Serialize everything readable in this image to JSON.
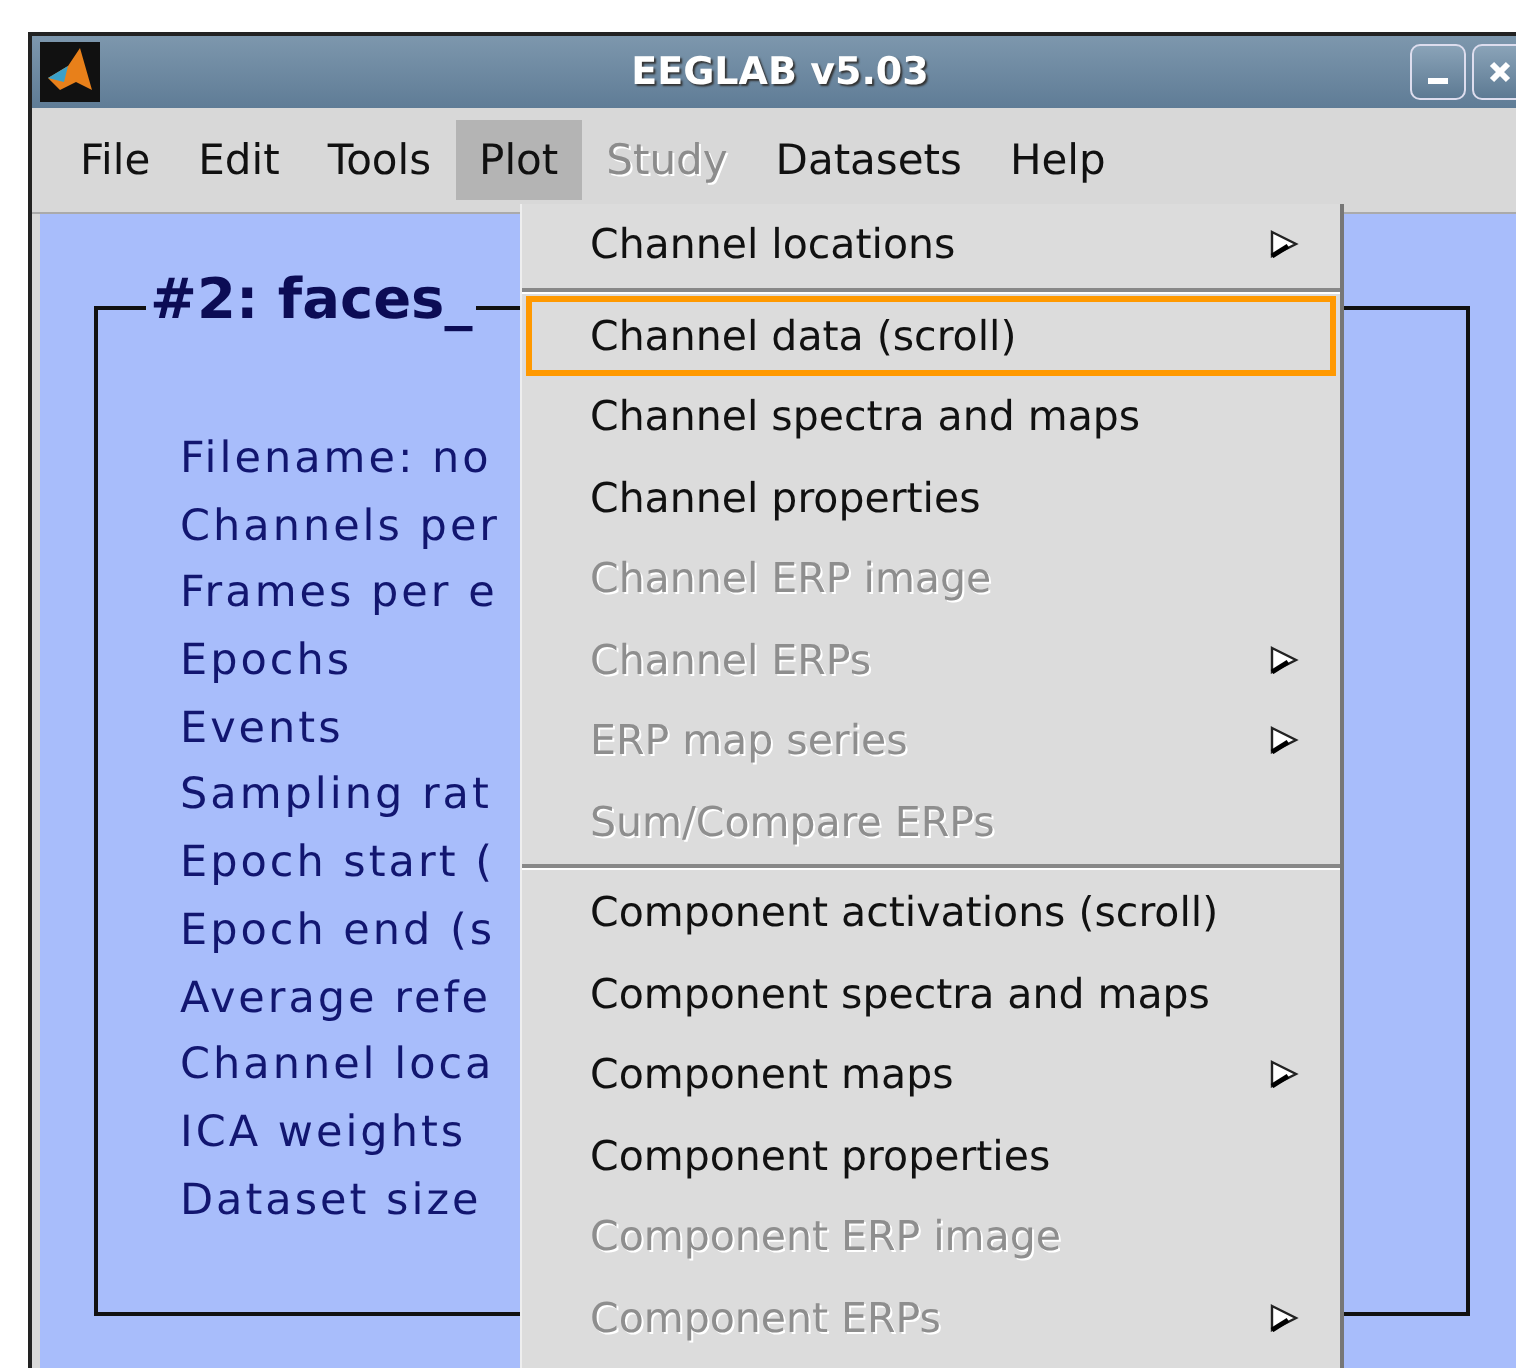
{
  "window": {
    "title": "EEGLAB v5.03"
  },
  "menubar": [
    {
      "label": "File",
      "selected": false,
      "disabled": false
    },
    {
      "label": "Edit",
      "selected": false,
      "disabled": false
    },
    {
      "label": "Tools",
      "selected": false,
      "disabled": false
    },
    {
      "label": "Plot",
      "selected": true,
      "disabled": false
    },
    {
      "label": "Study",
      "selected": false,
      "disabled": true
    },
    {
      "label": "Datasets",
      "selected": false,
      "disabled": false
    },
    {
      "label": "Help",
      "selected": false,
      "disabled": false
    }
  ],
  "dataset_panel": {
    "title": "#2: faces_",
    "fields": [
      "Filename: no",
      "Channels per",
      "Frames per e",
      "Epochs",
      "Events",
      "Sampling rat",
      "Epoch start (",
      "Epoch end (s",
      "Average refe",
      "Channel loca",
      "ICA weights",
      "Dataset size"
    ]
  },
  "plot_menu": {
    "groups": [
      [
        {
          "label": "Channel locations",
          "disabled": false,
          "submenu": true,
          "selected": false
        }
      ],
      [
        {
          "label": "Channel data (scroll)",
          "disabled": false,
          "submenu": false,
          "selected": true
        },
        {
          "label": "Channel spectra and maps",
          "disabled": false,
          "submenu": false,
          "selected": false
        },
        {
          "label": "Channel properties",
          "disabled": false,
          "submenu": false,
          "selected": false
        },
        {
          "label": "Channel ERP image",
          "disabled": true,
          "submenu": false,
          "selected": false
        },
        {
          "label": "Channel ERPs",
          "disabled": true,
          "submenu": true,
          "selected": false
        },
        {
          "label": "ERP map series",
          "disabled": true,
          "submenu": true,
          "selected": false
        },
        {
          "label": "Sum/Compare ERPs",
          "disabled": true,
          "submenu": false,
          "selected": false
        }
      ],
      [
        {
          "label": "Component activations (scroll)",
          "disabled": false,
          "submenu": false,
          "selected": false
        },
        {
          "label": "Component spectra and maps",
          "disabled": false,
          "submenu": false,
          "selected": false
        },
        {
          "label": "Component maps",
          "disabled": false,
          "submenu": true,
          "selected": false
        },
        {
          "label": "Component properties",
          "disabled": false,
          "submenu": false,
          "selected": false
        },
        {
          "label": "Component ERP image",
          "disabled": true,
          "submenu": false,
          "selected": false
        },
        {
          "label": "Component ERPs",
          "disabled": true,
          "submenu": true,
          "selected": false
        }
      ]
    ]
  }
}
